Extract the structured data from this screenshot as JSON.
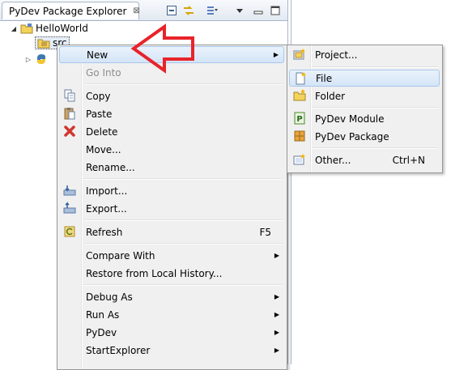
{
  "view": {
    "title": "PyDev Package Explorer",
    "close_glyph": "⊠"
  },
  "tree": [
    {
      "label": "HelloWorld",
      "icon": "project-folder-icon"
    },
    {
      "label": "src",
      "icon": "source-folder-icon"
    },
    {
      "label": "",
      "icon": "python-interpreter-icon"
    }
  ],
  "context_menu": {
    "items": [
      {
        "label": "New",
        "has_submenu": true
      },
      {
        "label": "Go Into",
        "disabled": true
      },
      {
        "label": "Copy",
        "icon": "copy-icon"
      },
      {
        "label": "Paste",
        "icon": "paste-icon"
      },
      {
        "label": "Delete",
        "icon": "delete-icon"
      },
      {
        "label": "Move..."
      },
      {
        "label": "Rename..."
      },
      {
        "label": "Import...",
        "icon": "import-icon"
      },
      {
        "label": "Export...",
        "icon": "export-icon"
      },
      {
        "label": "Refresh",
        "icon": "refresh-icon",
        "shortcut": "F5"
      },
      {
        "label": "Compare With",
        "has_submenu": true
      },
      {
        "label": "Restore from Local History..."
      },
      {
        "label": "Debug As",
        "has_submenu": true
      },
      {
        "label": "Run As",
        "has_submenu": true
      },
      {
        "label": "PyDev",
        "has_submenu": true
      },
      {
        "label": "StartExplorer",
        "has_submenu": true
      }
    ]
  },
  "new_submenu": {
    "items": [
      {
        "label": "Project...",
        "icon": "new-project-icon"
      },
      {
        "label": "File",
        "icon": "file-icon"
      },
      {
        "label": "Folder",
        "icon": "folder-icon"
      },
      {
        "label": "PyDev Module",
        "icon": "pydev-module-icon"
      },
      {
        "label": "PyDev Package",
        "icon": "pydev-package-icon"
      },
      {
        "label": "Other...",
        "icon": "other-wizard-icon",
        "shortcut": "Ctrl+N"
      }
    ]
  },
  "colors": {
    "annotation_arrow": "#e8232a",
    "menu_highlight_border": "#a8c8ec"
  }
}
